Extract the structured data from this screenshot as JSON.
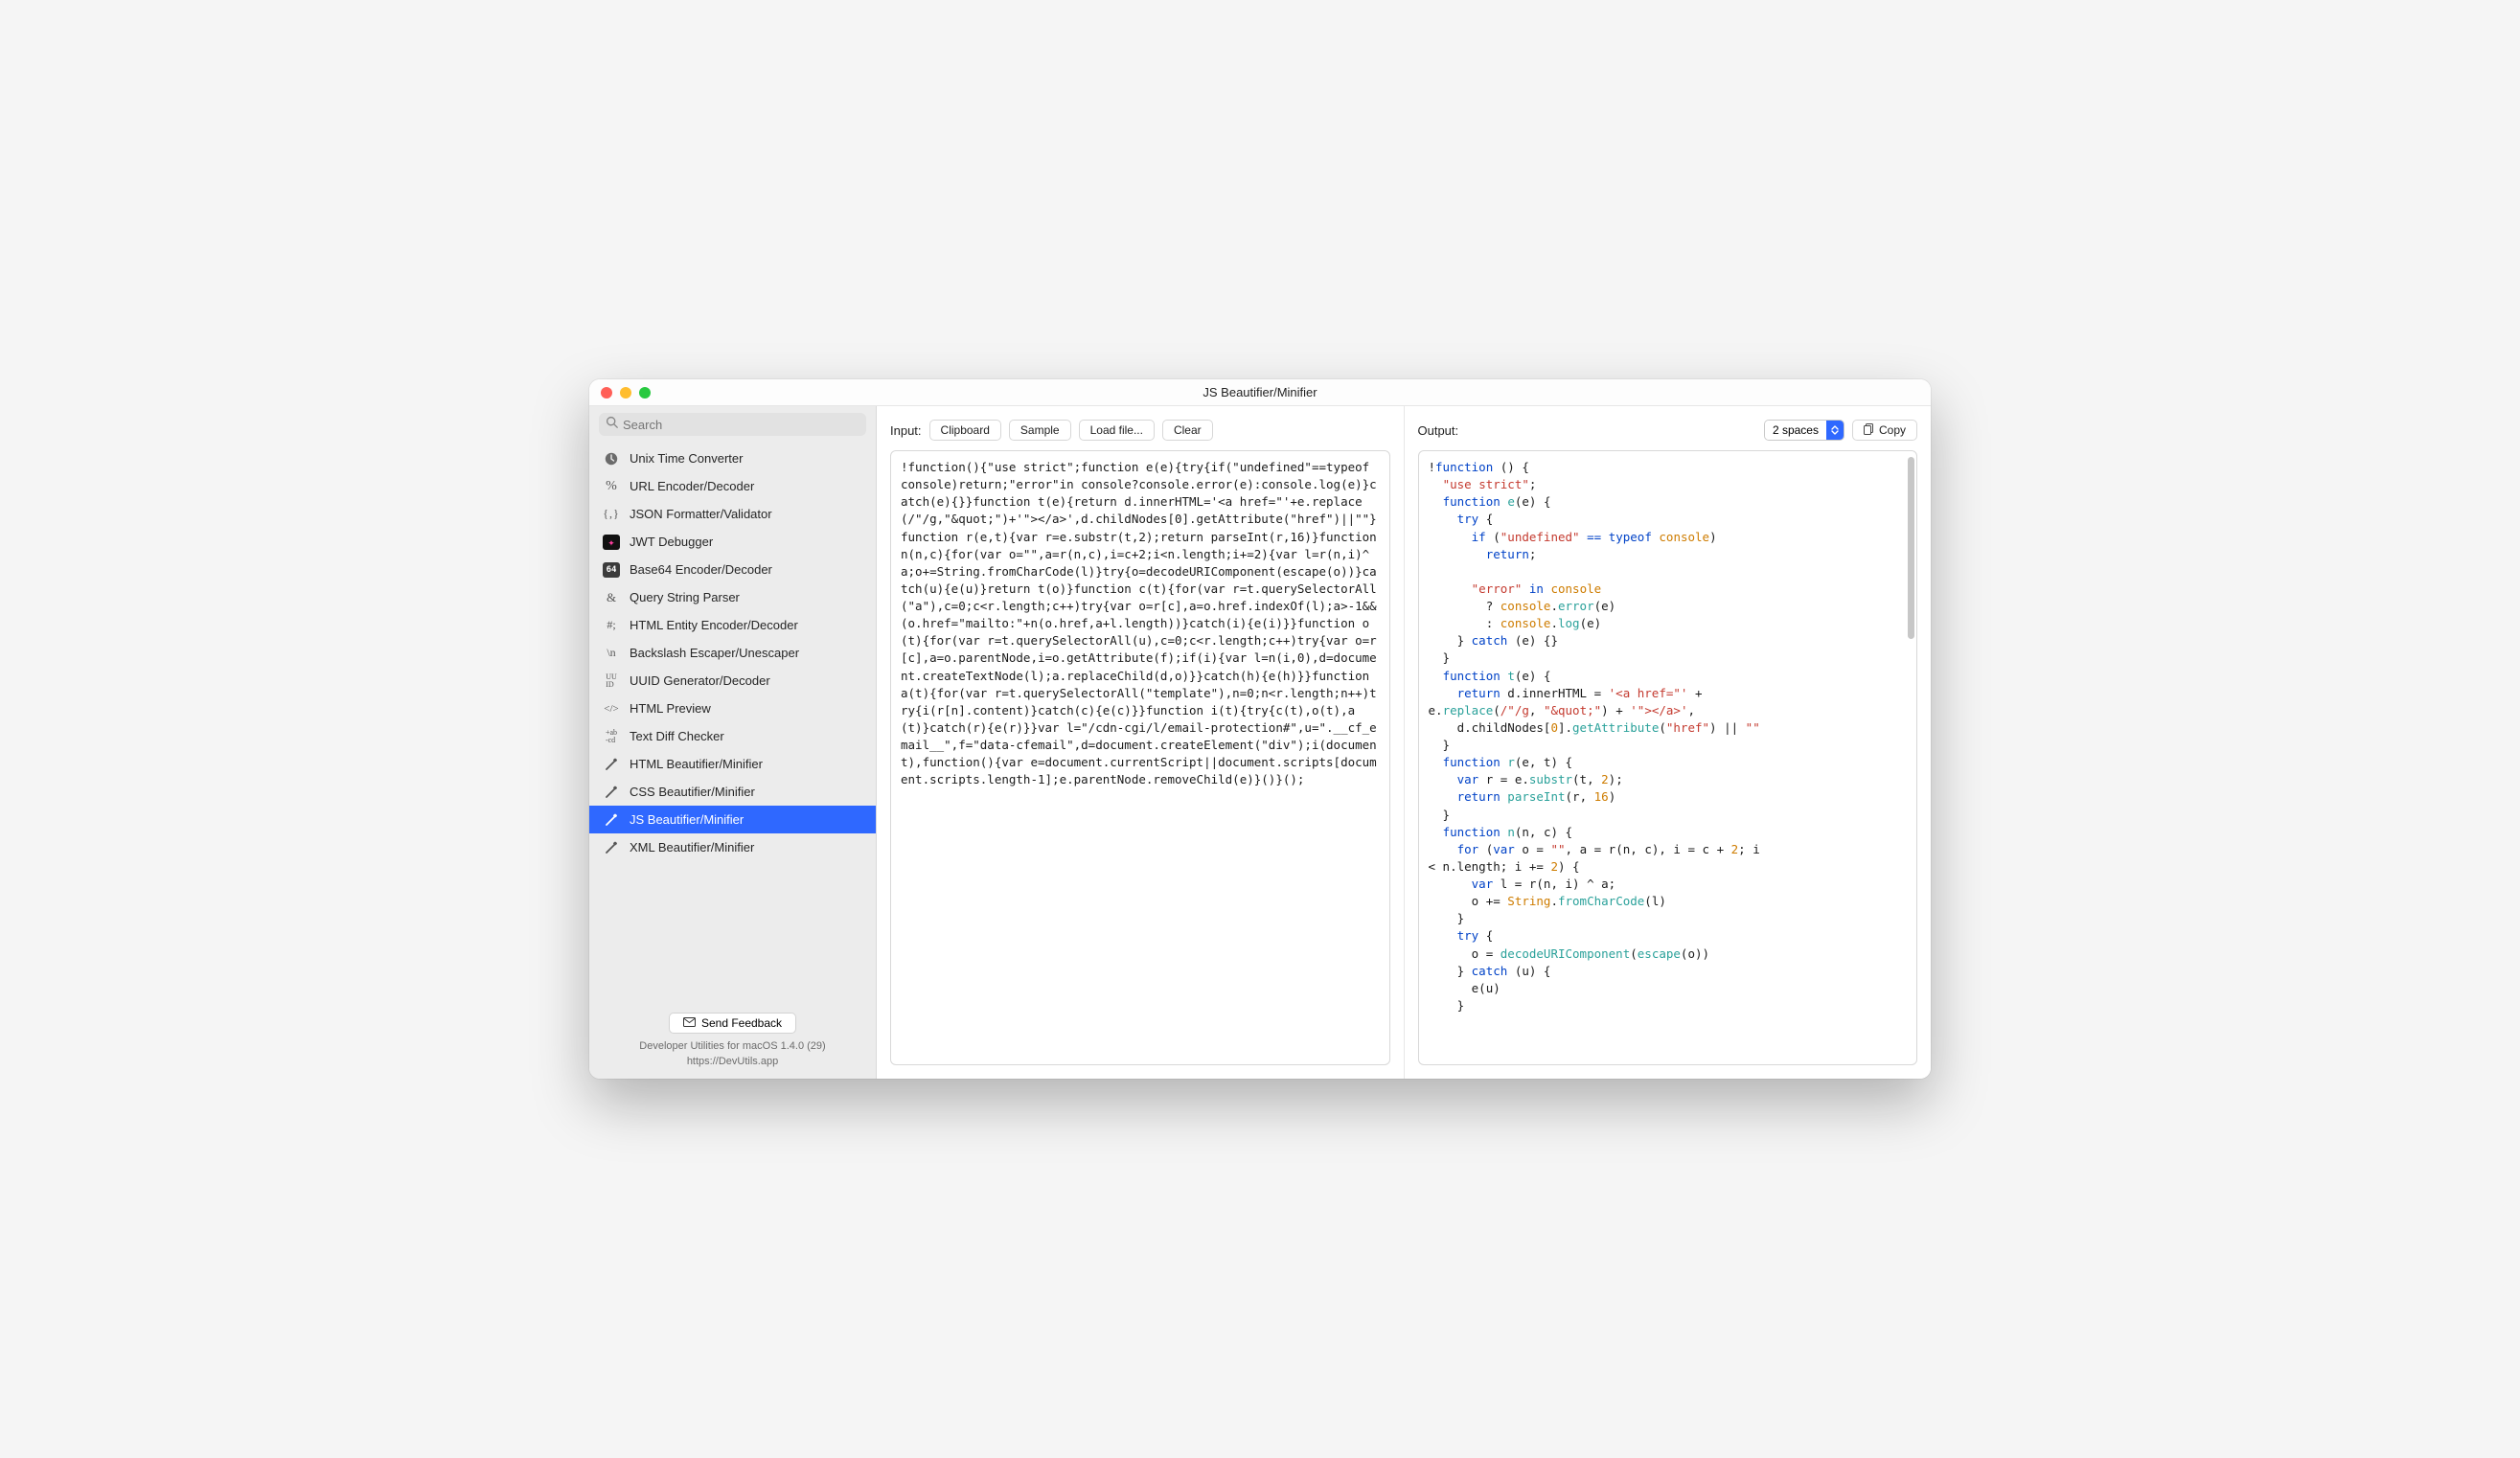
{
  "window": {
    "title": "JS Beautifier/Minifier"
  },
  "sidebar": {
    "search_placeholder": "Search",
    "items": [
      {
        "icon": "clock-icon",
        "label": "Unix Time Converter"
      },
      {
        "icon": "percent-icon",
        "label": "URL Encoder/Decoder"
      },
      {
        "icon": "braces-icon",
        "label": "JSON Formatter/Validator"
      },
      {
        "icon": "jwt-icon",
        "label": "JWT Debugger"
      },
      {
        "icon": "base64-icon",
        "label": "Base64 Encoder/Decoder"
      },
      {
        "icon": "qs-icon",
        "label": "Query String Parser"
      },
      {
        "icon": "hash-icon",
        "label": "HTML Entity Encoder/Decoder"
      },
      {
        "icon": "backslash-icon",
        "label": "Backslash Escaper/Unescaper"
      },
      {
        "icon": "uuid-icon",
        "label": "UUID Generator/Decoder"
      },
      {
        "icon": "code-icon",
        "label": "HTML Preview"
      },
      {
        "icon": "diff-icon",
        "label": "Text Diff Checker"
      },
      {
        "icon": "wand-icon",
        "label": "HTML Beautifier/Minifier"
      },
      {
        "icon": "wand-icon",
        "label": "CSS Beautifier/Minifier"
      },
      {
        "icon": "wand-icon",
        "label": "JS Beautifier/Minifier"
      },
      {
        "icon": "wand-icon",
        "label": "XML Beautifier/Minifier"
      }
    ],
    "active_index": 13,
    "feedback_label": "Send Feedback",
    "meta_line1": "Developer Utilities for macOS 1.4.0 (29)",
    "meta_line2": "https://DevUtils.app"
  },
  "input_panel": {
    "label": "Input:",
    "buttons": {
      "clipboard": "Clipboard",
      "sample": "Sample",
      "loadfile": "Load file...",
      "clear": "Clear"
    },
    "content": "!function(){\"use strict\";function e(e){try{if(\"undefined\"==typeof console)return;\"error\"in console?console.error(e):console.log(e)}catch(e){}}function t(e){return d.innerHTML='<a href=\"'+e.replace(/\"/g,\"&quot;\")+'\"></a>',d.childNodes[0].getAttribute(\"href\")||\"\"}function r(e,t){var r=e.substr(t,2);return parseInt(r,16)}function n(n,c){for(var o=\"\",a=r(n,c),i=c+2;i<n.length;i+=2){var l=r(n,i)^a;o+=String.fromCharCode(l)}try{o=decodeURIComponent(escape(o))}catch(u){e(u)}return t(o)}function c(t){for(var r=t.querySelectorAll(\"a\"),c=0;c<r.length;c++)try{var o=r[c],a=o.href.indexOf(l);a>-1&&(o.href=\"mailto:\"+n(o.href,a+l.length))}catch(i){e(i)}}function o(t){for(var r=t.querySelectorAll(u),c=0;c<r.length;c++)try{var o=r[c],a=o.parentNode,i=o.getAttribute(f);if(i){var l=n(i,0),d=document.createTextNode(l);a.replaceChild(d,o)}}catch(h){e(h)}}function a(t){for(var r=t.querySelectorAll(\"template\"),n=0;n<r.length;n++)try{i(r[n].content)}catch(c){e(c)}}function i(t){try{c(t),o(t),a(t)}catch(r){e(r)}}var l=\"/cdn-cgi/l/email-protection#\",u=\".__cf_email__\",f=\"data-cfemail\",d=document.createElement(\"div\");i(document),function(){var e=document.currentScript||document.scripts[document.scripts.length-1];e.parentNode.removeChild(e)}()}();"
  },
  "output_panel": {
    "label": "Output:",
    "indent_select": "2 spaces",
    "copy_label": "Copy"
  }
}
